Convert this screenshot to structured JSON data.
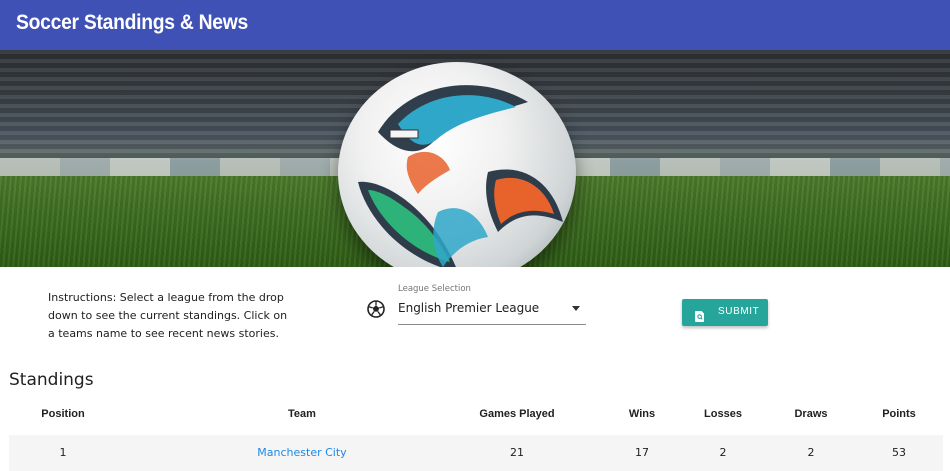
{
  "app": {
    "title": "Soccer Standings & News"
  },
  "hero": {
    "image": "soccer-ball-on-stadium-pitch"
  },
  "controls": {
    "instructions": "Instructions: Select a league from the drop down to see the current standings. Click on a teams name to see recent news stories.",
    "league_label": "League Selection",
    "league_value": "English Premier League",
    "submit_label": "SUBMIT"
  },
  "standings": {
    "title": "Standings",
    "columns": [
      "Position",
      "Team",
      "Games Played",
      "Wins",
      "Losses",
      "Draws",
      "Points"
    ],
    "rows": [
      {
        "position": "1",
        "team": "Manchester City",
        "games_played": "21",
        "wins": "17",
        "losses": "2",
        "draws": "2",
        "points": "53"
      }
    ]
  },
  "colors": {
    "appbar": "#3f51b5",
    "button": "#26a69a",
    "link": "#1e88e5"
  }
}
